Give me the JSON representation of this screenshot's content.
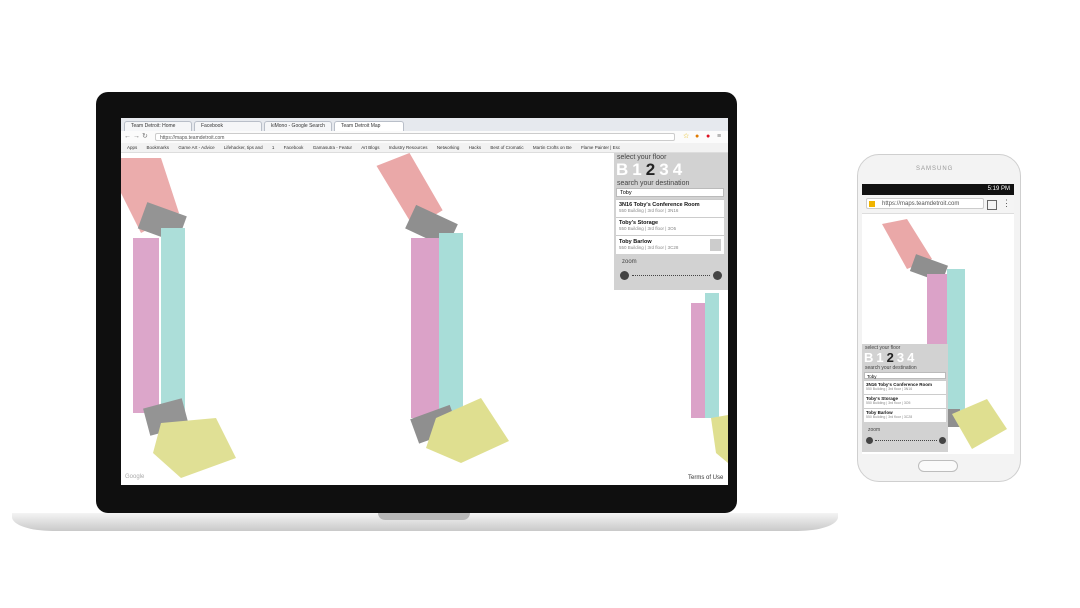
{
  "browser": {
    "tabs": [
      "Team Detroit: Home",
      "Facebook",
      "kiMono - Google Search",
      "Team Detroit Map"
    ],
    "url": "https://maps.teamdetroit.com",
    "bookmarks": [
      "Apps",
      "Bookmarks",
      "Game Art - Advice",
      "Lifehacker, tips and",
      "1",
      "Facebook",
      "Gamasutra - Featur",
      "Art Blogs",
      "Industry Resources",
      "Networking",
      "Hacks",
      "Best of Cromatic",
      "Martin Crofts on Be",
      "Flame Painter | Esc"
    ]
  },
  "panel": {
    "select_floor": "select your floor",
    "floors": [
      "B",
      "1",
      "2",
      "3",
      "4"
    ],
    "active_floor": "2",
    "search_label": "search your destination",
    "search_value": "Toby",
    "results": [
      {
        "title": "3N16 Toby's Conference Room",
        "sub": "550 Building | 3rd floor | 3N16"
      },
      {
        "title": "Toby's Storage",
        "sub": "550 Building | 3rd floor | 3O5"
      },
      {
        "title": "Toby Barlow",
        "sub": "550 Building | 3rd floor | 3C28"
      }
    ],
    "zoom_label": "zoom",
    "zoom_level": 0.5
  },
  "map": {
    "terms": "Terms of Use",
    "google": "Google"
  },
  "phone": {
    "brand": "SAMSUNG",
    "time": "5:19 PM",
    "url": "https://maps.teamdetroit.com"
  },
  "colors": {
    "pink_wing": "#e8a6a6",
    "teal_wing": "#a6dcd6",
    "magenta_wing": "#d9a0c4",
    "yellow_wing": "#dede8c",
    "gray_wing": "#9e9e9e"
  }
}
